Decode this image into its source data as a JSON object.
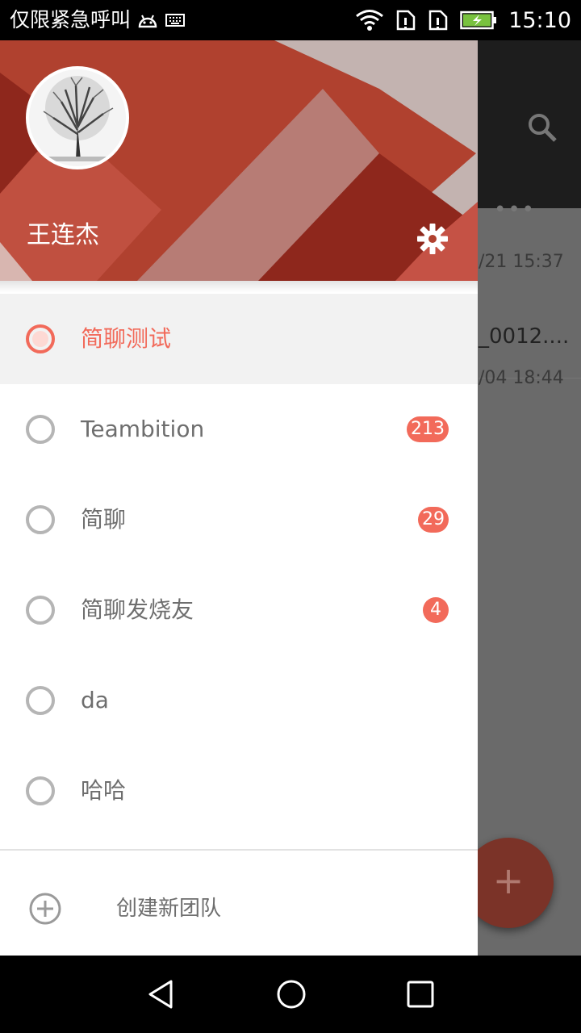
{
  "status_bar": {
    "carrier": "仅限紧急呼叫",
    "time": "15:10",
    "icons": [
      "android-debug-icon",
      "keyboard-icon",
      "wifi-icon",
      "sim1-alert-icon",
      "sim2-alert-icon",
      "battery-charging-icon"
    ]
  },
  "background_app": {
    "conversations": [
      {
        "time": "/21 15:37",
        "preview": "_0012...."
      },
      {
        "time": "/04 18:44"
      }
    ],
    "fab_label": "+"
  },
  "drawer": {
    "user_name": "王连杰",
    "teams": [
      {
        "name": "简聊测试",
        "badge": "",
        "selected": true
      },
      {
        "name": "Teambition",
        "badge": "213",
        "selected": false
      },
      {
        "name": "简聊",
        "badge": "29",
        "selected": false
      },
      {
        "name": "简聊发烧友",
        "badge": "4",
        "selected": false
      },
      {
        "name": "da",
        "badge": "",
        "selected": false
      },
      {
        "name": "哈哈",
        "badge": "",
        "selected": false
      }
    ],
    "create_team_label": "创建新团队"
  },
  "colors": {
    "accent": "#f26a5a",
    "header_red": "#b0412f",
    "header_dark": "#8e271c",
    "header_pink": "#b77c75",
    "header_light": "#c3b3b0"
  }
}
